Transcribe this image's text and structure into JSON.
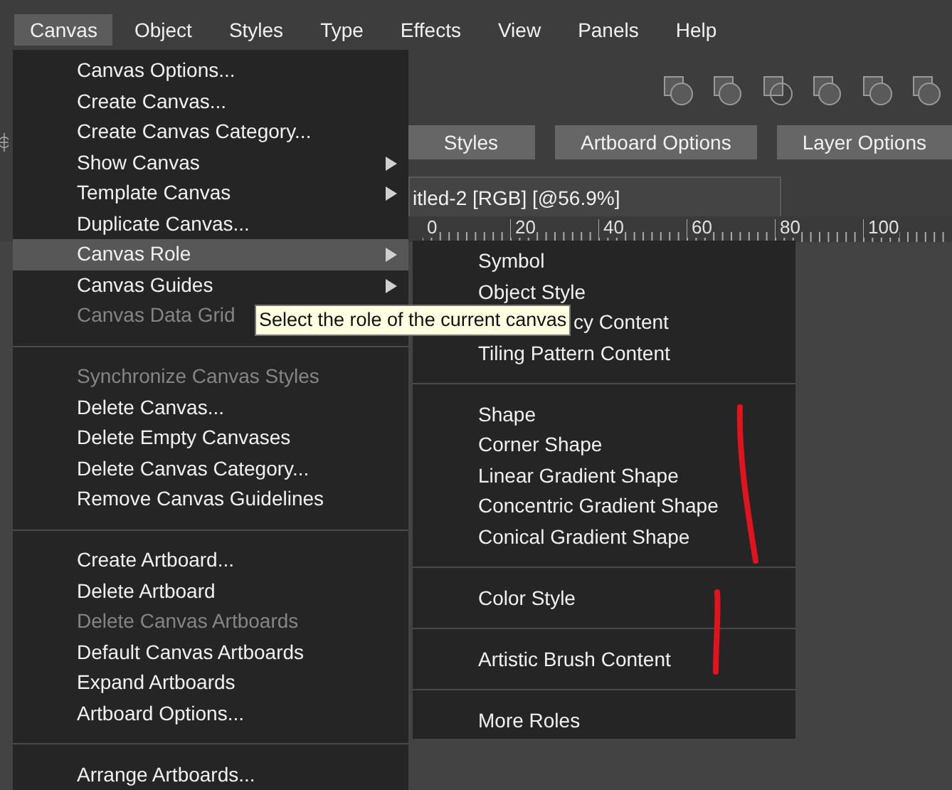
{
  "menubar": [
    {
      "label": "Canvas",
      "selected": true
    },
    {
      "label": "Object",
      "selected": false
    },
    {
      "label": "Styles",
      "selected": false
    },
    {
      "label": "Type",
      "selected": false
    },
    {
      "label": "Effects",
      "selected": false
    },
    {
      "label": "View",
      "selected": false
    },
    {
      "label": "Panels",
      "selected": false
    },
    {
      "label": "Help",
      "selected": false
    }
  ],
  "toolbar_buttons": [
    "Styles",
    "Artboard Options",
    "Layer Options"
  ],
  "document_tab": {
    "title": "itled-2 [RGB] [@56.9%]"
  },
  "ruler": {
    "labels": [
      "0",
      "20",
      "40",
      "60",
      "80",
      "100"
    ]
  },
  "menu": {
    "groups": [
      [
        {
          "label": "Canvas Options...",
          "submenu": false,
          "disabled": false,
          "selected": false
        },
        {
          "label": "Create Canvas...",
          "submenu": false,
          "disabled": false,
          "selected": false
        },
        {
          "label": "Create Canvas Category...",
          "submenu": false,
          "disabled": false,
          "selected": false
        },
        {
          "label": "Show Canvas",
          "submenu": true,
          "disabled": false,
          "selected": false
        },
        {
          "label": "Template Canvas",
          "submenu": true,
          "disabled": false,
          "selected": false
        },
        {
          "label": "Duplicate Canvas...",
          "submenu": false,
          "disabled": false,
          "selected": false
        },
        {
          "label": "Canvas Role",
          "submenu": true,
          "disabled": false,
          "selected": true
        },
        {
          "label": "Canvas Guides",
          "submenu": true,
          "disabled": false,
          "selected": false
        },
        {
          "label": "Canvas Data Grid",
          "submenu": false,
          "disabled": true,
          "selected": false
        }
      ],
      [
        {
          "label": "Synchronize Canvas Styles",
          "submenu": false,
          "disabled": true,
          "selected": false
        },
        {
          "label": "Delete Canvas...",
          "submenu": false,
          "disabled": false,
          "selected": false
        },
        {
          "label": "Delete Empty Canvases",
          "submenu": false,
          "disabled": false,
          "selected": false
        },
        {
          "label": "Delete Canvas Category...",
          "submenu": false,
          "disabled": false,
          "selected": false
        },
        {
          "label": "Remove Canvas Guidelines",
          "submenu": false,
          "disabled": false,
          "selected": false
        }
      ],
      [
        {
          "label": "Create Artboard...",
          "submenu": false,
          "disabled": false,
          "selected": false
        },
        {
          "label": "Delete Artboard",
          "submenu": false,
          "disabled": false,
          "selected": false
        },
        {
          "label": "Delete Canvas Artboards",
          "submenu": false,
          "disabled": true,
          "selected": false
        },
        {
          "label": "Default Canvas Artboards",
          "submenu": false,
          "disabled": false,
          "selected": false
        },
        {
          "label": "Expand Artboards",
          "submenu": false,
          "disabled": false,
          "selected": false
        },
        {
          "label": "Artboard Options...",
          "submenu": false,
          "disabled": false,
          "selected": false
        }
      ],
      [
        {
          "label": "Arrange Artboards...",
          "submenu": false,
          "disabled": false,
          "selected": false
        }
      ]
    ]
  },
  "submenu": {
    "groups": [
      [
        {
          "label": "Symbol",
          "covered": false
        },
        {
          "label": "Object Style",
          "covered": false
        },
        {
          "label": "cy Content",
          "covered": true
        },
        {
          "label": "Tiling Pattern Content",
          "covered": false
        }
      ],
      [
        {
          "label": "Shape",
          "covered": false
        },
        {
          "label": "Corner Shape",
          "covered": false
        },
        {
          "label": "Linear Gradient Shape",
          "covered": false
        },
        {
          "label": "Concentric Gradient Shape",
          "covered": false
        },
        {
          "label": "Conical Gradient Shape",
          "covered": false
        }
      ],
      [
        {
          "label": "Color Style",
          "covered": false
        }
      ],
      [
        {
          "label": "Artistic Brush Content",
          "covered": false
        }
      ],
      [
        {
          "label": "More Roles",
          "covered": false
        }
      ]
    ]
  },
  "tooltip": "Select the role of the current canvas"
}
